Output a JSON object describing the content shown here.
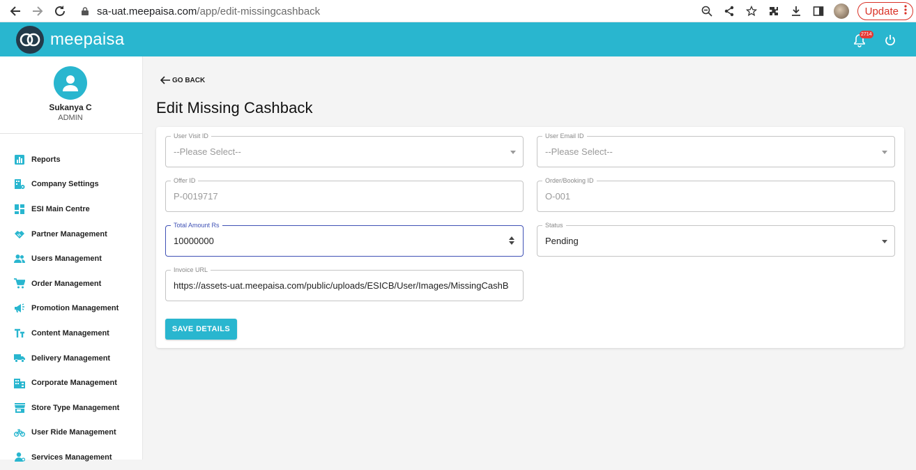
{
  "browser": {
    "url_host": "sa-uat.meepaisa.com",
    "url_path": "/app/edit-missingcashback",
    "update_label": "Update"
  },
  "header": {
    "brand": "meepaisa",
    "notification_count": "2714",
    "color": "#29b6cf"
  },
  "profile": {
    "name": "Sukanya C",
    "role": "ADMIN"
  },
  "sidebar": {
    "items": [
      {
        "label": "Reports",
        "icon": "bar-chart-icon"
      },
      {
        "label": "Company Settings",
        "icon": "company-settings-icon"
      },
      {
        "label": "ESI Main Centre",
        "icon": "dashboard-icon"
      },
      {
        "label": "Partner Management",
        "icon": "handshake-icon"
      },
      {
        "label": "Users Management",
        "icon": "users-icon"
      },
      {
        "label": "Order Management",
        "icon": "cart-icon"
      },
      {
        "label": "Promotion Management",
        "icon": "megaphone-icon"
      },
      {
        "label": "Content Management",
        "icon": "text-icon"
      },
      {
        "label": "Delivery Management",
        "icon": "truck-icon"
      },
      {
        "label": "Corporate Management",
        "icon": "building-icon"
      },
      {
        "label": "Store Type Management",
        "icon": "store-icon"
      },
      {
        "label": "User Ride Management",
        "icon": "bike-icon"
      },
      {
        "label": "Services Management",
        "icon": "service-icon"
      }
    ]
  },
  "main": {
    "go_back": "GO BACK",
    "title": "Edit Missing Cashback",
    "fields": {
      "user_visit_id": {
        "label": "User Visit ID",
        "value": "--Please Select--"
      },
      "user_email_id": {
        "label": "User Email ID",
        "value": "--Please Select--"
      },
      "offer_id": {
        "label": "Offer ID",
        "value": "P-0019717"
      },
      "order_booking_id": {
        "label": "Order/Booking ID",
        "value": "O-001"
      },
      "total_amount": {
        "label": "Total Amount Rs",
        "value": "10000000"
      },
      "status": {
        "label": "Status",
        "value": "Pending"
      },
      "invoice_url": {
        "label": "Invoice URL",
        "value": "https://assets-uat.meepaisa.com/public/uploads/ESICB/User/Images/MissingCashB"
      }
    },
    "save_label": "SAVE DETAILS"
  }
}
